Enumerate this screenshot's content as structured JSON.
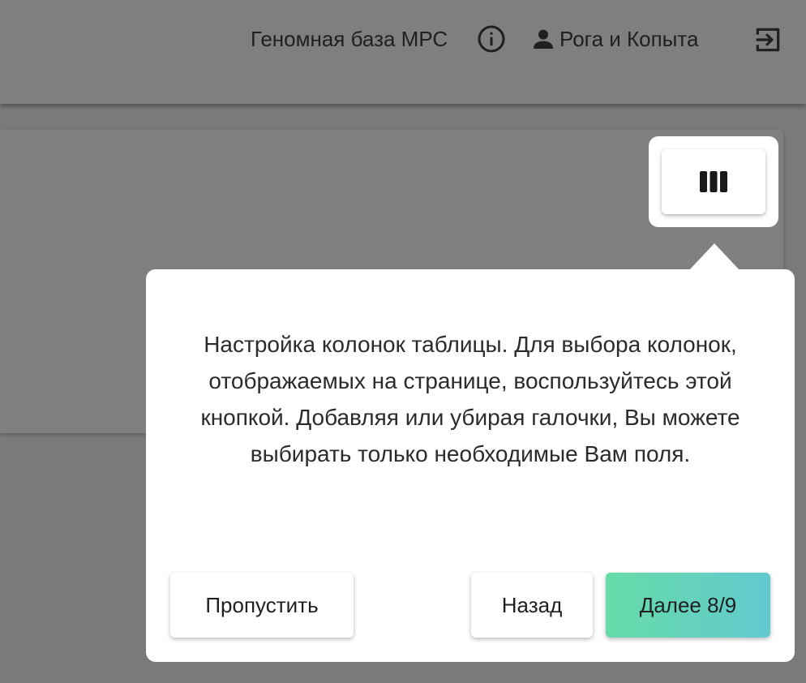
{
  "header": {
    "title": "Геномная база МРС",
    "user_name": "Рога и Копыта",
    "icons": {
      "info": "info-circle-icon",
      "user": "user-icon",
      "logout": "logout-icon"
    }
  },
  "target": {
    "icon": "view-columns-icon"
  },
  "tour": {
    "text": "Настройка колонок таблицы. Для выбора колонок, отображаемых на странице, воспользуйтесь этой кнопкой. Добавляя или убирая галочки, Вы можете выбирать только необходимые Вам поля.",
    "skip_label": "Пропустить",
    "back_label": "Назад",
    "next_label": "Далее 8/9"
  },
  "colors": {
    "overlay": "#7a7a7a",
    "next_gradient_start": "#66dca8",
    "next_gradient_end": "#62c9cf"
  }
}
